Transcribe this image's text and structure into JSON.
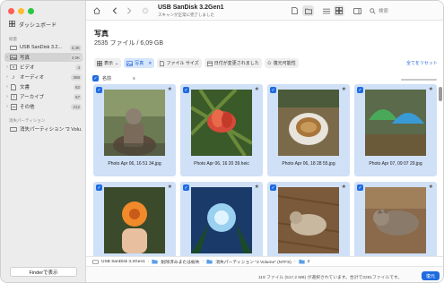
{
  "sidebar": {
    "dashboard_label": "ダッシュボード",
    "section_1": "総量",
    "items": [
      {
        "label": "USB SanDisk 3.2...",
        "count": "3,3K"
      },
      {
        "label": "写真",
        "count": "2,5K"
      },
      {
        "label": "ビデオ",
        "count": "4"
      },
      {
        "label": "オーディオ",
        "count": "398"
      },
      {
        "label": "文書",
        "count": "82"
      },
      {
        "label": "アーカイブ",
        "count": "57"
      },
      {
        "label": "その他",
        "count": "212"
      }
    ],
    "section_2": "消失パーティション",
    "lost_partition": "消失パーティション \"2 Volu...",
    "finder_button": "Finderで表示"
  },
  "topbar": {
    "title": "USB SanDisk 3.2Gen1",
    "subtitle": "スキャンが正常に完了しました",
    "search_placeholder": "検索"
  },
  "header": {
    "title": "写真",
    "summary": "2535 ファイル / 6,09 GB"
  },
  "filters": {
    "view": "表示",
    "photos": "写真",
    "file_size": "ファイル サイズ",
    "date_changed": "日付が変更されました",
    "recoverability": "復元可能性",
    "reset_all": "全てをリセット"
  },
  "list": {
    "name_col": "名前"
  },
  "tiles": [
    {
      "name": "Photo Apr 06, 16 51 34.jpg"
    },
    {
      "name": "Photo Apr 06, 16 20 39.heic"
    },
    {
      "name": "Photo Apr 06, 18 28 55.jpg"
    },
    {
      "name": "Photo Apr 07, 09 07 29.jpg"
    },
    {
      "name": ""
    },
    {
      "name": ""
    },
    {
      "name": ""
    },
    {
      "name": ""
    }
  ],
  "pathbar": {
    "items": [
      "USB SanDisk 3.2Gen1",
      "削除済みまたは紛失",
      "消失パーティション \"2 Volume\" (NTFS)",
      "3"
    ]
  },
  "status": {
    "text": "119 ファイル (517,2 MB) が選択されています。合計で3291ファイルです。",
    "restore_button": "復元"
  },
  "colors": {
    "accent": "#1f6be0",
    "tile_selected": "#cfe0f7"
  }
}
